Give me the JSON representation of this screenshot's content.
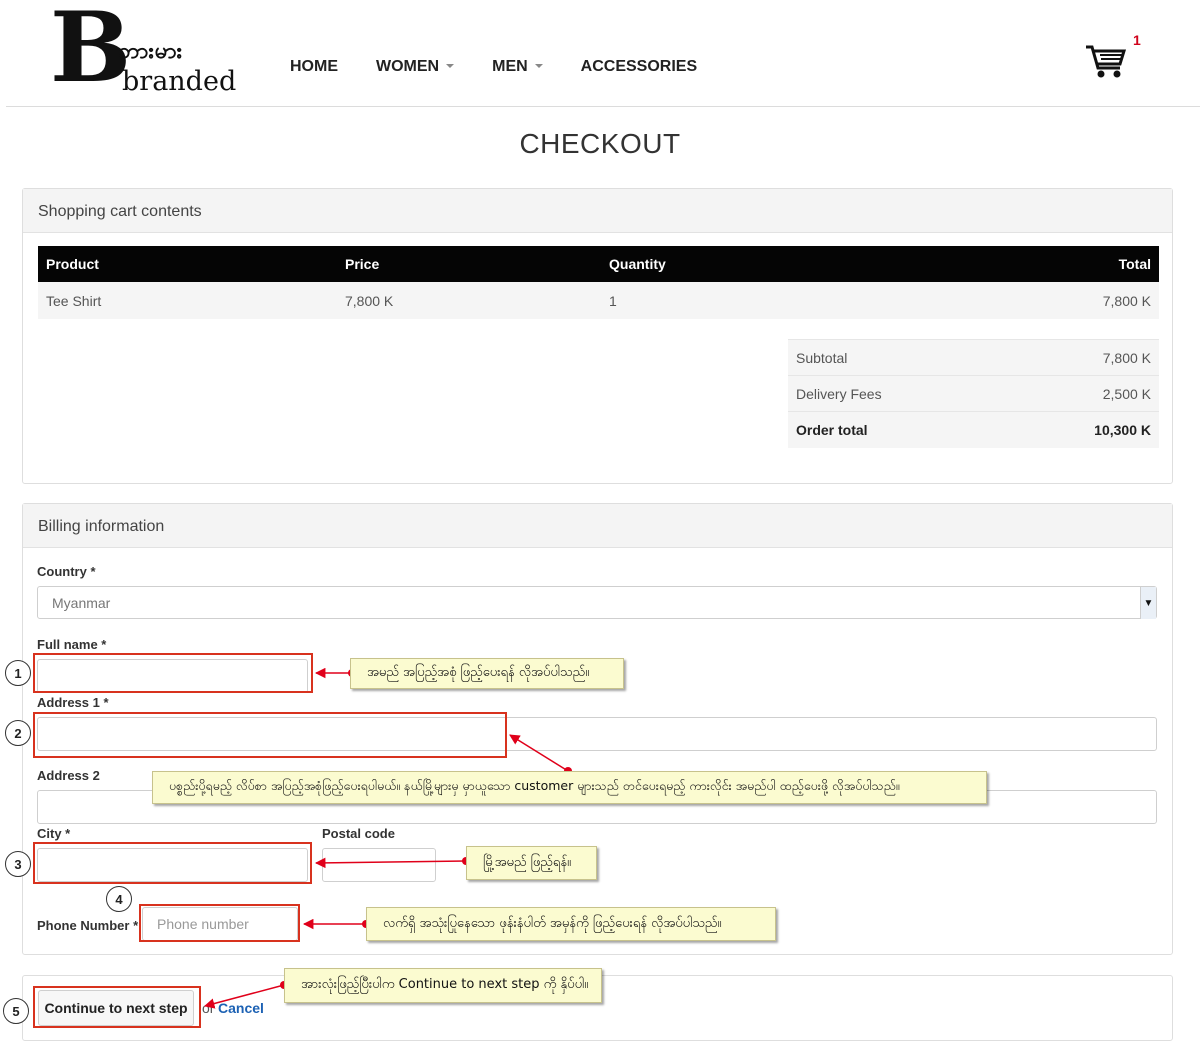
{
  "brand": {
    "logo_letter": "B",
    "logo_myanmar": "ဘားမား",
    "logo_english": "branded"
  },
  "nav": [
    {
      "label": "HOME",
      "dropdown": false
    },
    {
      "label": "WOMEN",
      "dropdown": true
    },
    {
      "label": "MEN",
      "dropdown": true
    },
    {
      "label": "ACCESSORIES",
      "dropdown": false
    }
  ],
  "cart": {
    "icon": "shopping-cart-icon",
    "count": "1"
  },
  "page": {
    "title": "CHECKOUT"
  },
  "cart_panel": {
    "heading": "Shopping cart contents",
    "columns": [
      "Product",
      "Price",
      "Quantity",
      "Total"
    ],
    "rows": [
      {
        "product": "Tee Shirt",
        "price": "7,800 K",
        "quantity": "1",
        "total": "7,800 K"
      }
    ],
    "subtotal_label": "Subtotal",
    "subtotal_value": "7,800 K",
    "delivery_label": "Delivery Fees",
    "delivery_value": "2,500 K",
    "order_total_label": "Order total",
    "order_total_value": "10,300 K"
  },
  "billing": {
    "heading": "Billing information",
    "country_label": "Country *",
    "country_value": "Myanmar",
    "fullname_label": "Full name *",
    "fullname_value": "",
    "address1_label": "Address 1 *",
    "address1_value": "",
    "address2_label": "Address 2",
    "address2_value": "",
    "city_label": "City *",
    "city_value": "",
    "postal_label": "Postal code",
    "postal_value": "",
    "phone_label": "Phone Number *",
    "phone_placeholder": "Phone number"
  },
  "actions": {
    "continue_label": "Continue to next step",
    "or_label": "or",
    "cancel_label": "Cancel"
  },
  "annotations": {
    "numbers": [
      "1",
      "2",
      "3",
      "4",
      "5"
    ],
    "note1": "အမည် အပြည့်အစုံ ဖြည့်ပေးရန် လိုအပ်ပါသည်။",
    "note2": "ပစ္စည်းပို့ရမည့် လိပ်စာ အပြည့်အစုံဖြည့်ပေးရပါမယ်။ နယ်မြို့များမှ မှာယူသော customer များသည် တင်ပေးရမည့် ကားလိုင်း အမည်ပါ ထည့်ပေးဖို့ လိုအပ်ပါသည်။",
    "note3": "မြို့အမည် ဖြည့်ရန်။",
    "note4": "လက်ရှိ အသုံးပြုနေသော ဖုန်းနံပါတ် အမှန်ကို ဖြည့်ပေးရန် လိုအပ်ပါသည်။",
    "note5": "အားလုံးဖြည့်ပြီးပါက Continue to next step ကို နှိပ်ပါ။",
    "highlight_color": "#d8321e",
    "note_color": "#fbfbd0"
  }
}
